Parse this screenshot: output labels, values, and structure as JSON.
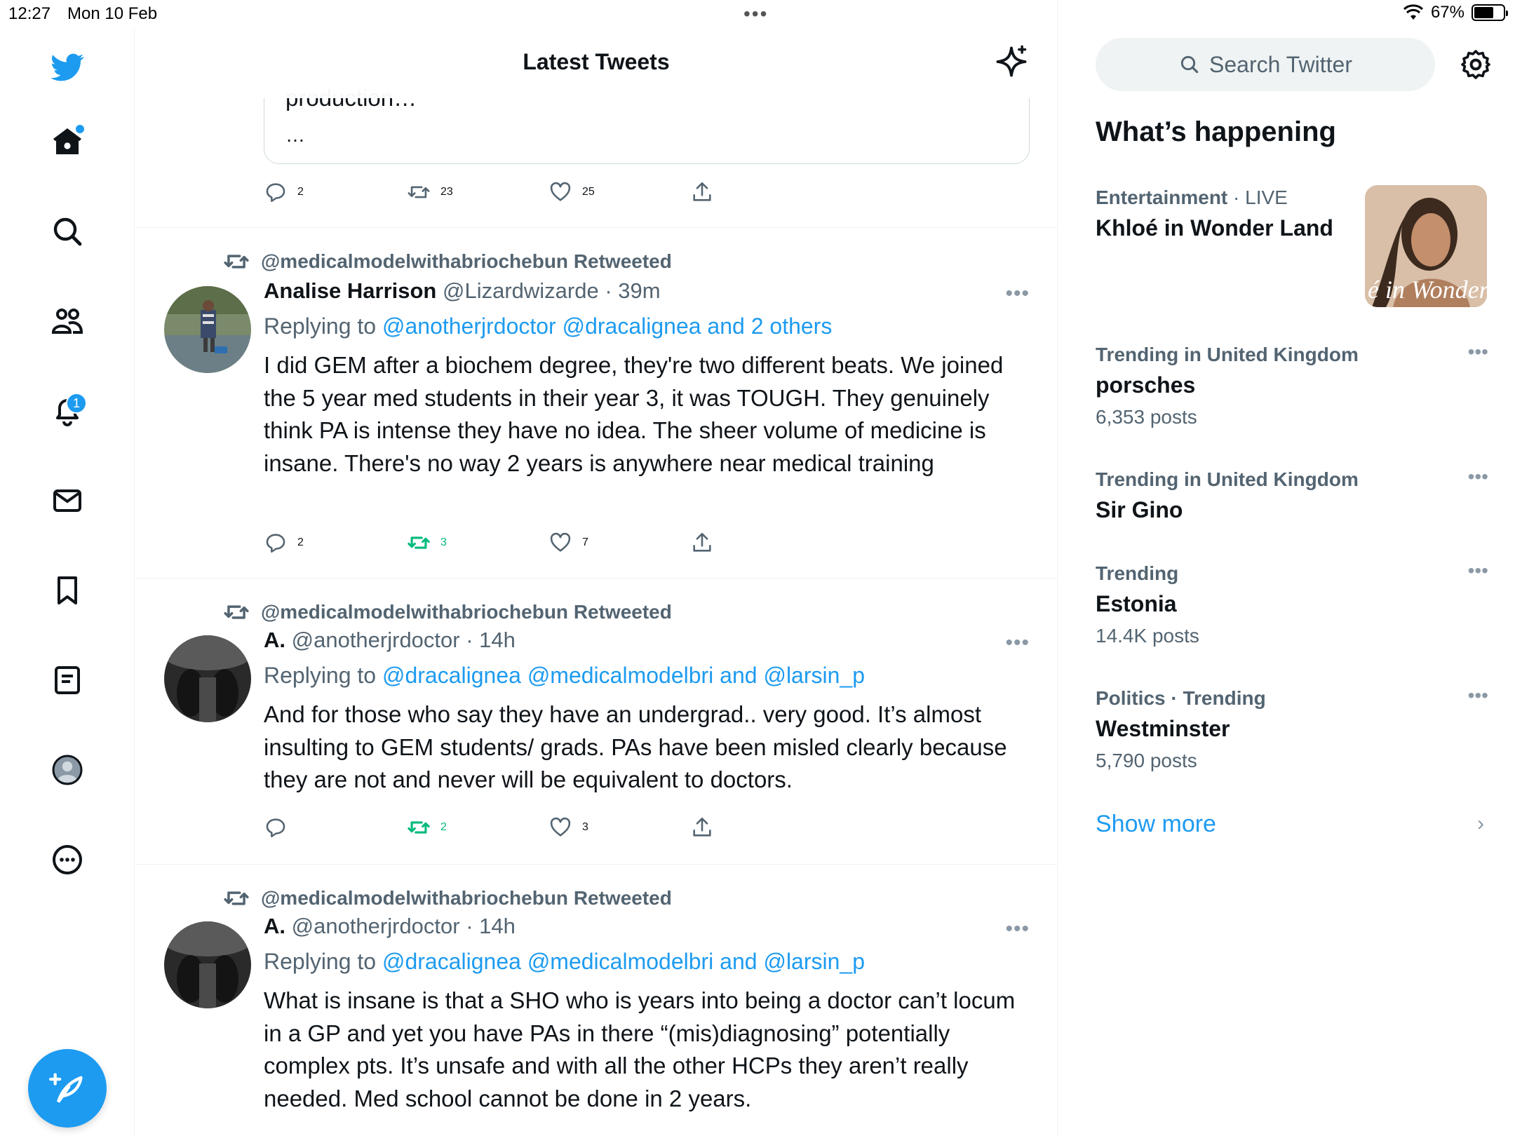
{
  "status": {
    "time": "12:27",
    "date": "Mon 10 Feb",
    "battery": "67%",
    "battery_level": 0.67
  },
  "nav": {
    "notifications_badge": "1"
  },
  "timeline": {
    "title": "Latest Tweets",
    "quoted_text": "production…",
    "quoted_ellipsis": "…",
    "top_actions": {
      "replies": "2",
      "retweets": "23",
      "likes": "25"
    }
  },
  "tweets": [
    {
      "retweeted_by": "@medicalmodelwithabriochebun Retweeted",
      "name": "Analise Harrison",
      "handle": "@Lizardwizarde",
      "time": "39m",
      "replying_prefix": "Replying to",
      "replying_to": "@anotherjrdoctor @dracalignea and 2 others",
      "text": "I did GEM after a biochem degree, they're two different beats. We joined the 5 year med students in their year 3, it was TOUGH. They genuinely think PA is intense they have no idea. The sheer volume of medicine is insane. There's no way 2 years is anywhere near medical training",
      "replies": "2",
      "retweets": "3",
      "likes": "7"
    },
    {
      "retweeted_by": "@medicalmodelwithabriochebun Retweeted",
      "name": "A.",
      "handle": "@anotherjrdoctor",
      "time": "14h",
      "replying_prefix": "Replying to",
      "replying_to": "@dracalignea @medicalmodelbri and @larsin_p",
      "text": "And for those who say they have an undergrad.. very good. It’s almost insulting to GEM students/ grads. PAs have been misled clearly because they are not and never will be equivalent to doctors.",
      "replies": "",
      "retweets": "2",
      "likes": "3"
    },
    {
      "retweeted_by": "@medicalmodelwithabriochebun Retweeted",
      "name": "A.",
      "handle": "@anotherjrdoctor",
      "time": "14h",
      "replying_prefix": "Replying to",
      "replying_to": "@dracalignea @medicalmodelbri and @larsin_p",
      "text": "What is insane is that a SHO who is years into being a doctor can’t locum in a GP and yet you have PAs in there “(mis)diagnosing” potentially complex pts. It’s unsafe and with all the other HCPs they aren’t really needed. Med school cannot be done in 2 years."
    }
  ],
  "sidebar": {
    "search_placeholder": "Search Twitter",
    "whats_happening": "What’s happening",
    "trends": [
      {
        "category": "Entertainment",
        "sub": "· LIVE",
        "name": "Khloé in Wonder Land",
        "count": "",
        "image_text": "é in Wonder l"
      },
      {
        "category": "Trending in United Kingdom",
        "sub": "",
        "name": "porsches",
        "count": "6,353 posts"
      },
      {
        "category": "Trending in United Kingdom",
        "sub": "",
        "name": "Sir Gino",
        "count": ""
      },
      {
        "category": "Trending",
        "sub": "",
        "name": "Estonia",
        "count": "14.4K posts"
      },
      {
        "category": "Politics · Trending",
        "sub": "",
        "name": "Westminster",
        "count": "5,790 posts"
      }
    ],
    "show_more": "Show more"
  },
  "colors": {
    "accent": "#1d9bf0",
    "retweet_active": "#00ba7c",
    "muted": "#536471"
  }
}
